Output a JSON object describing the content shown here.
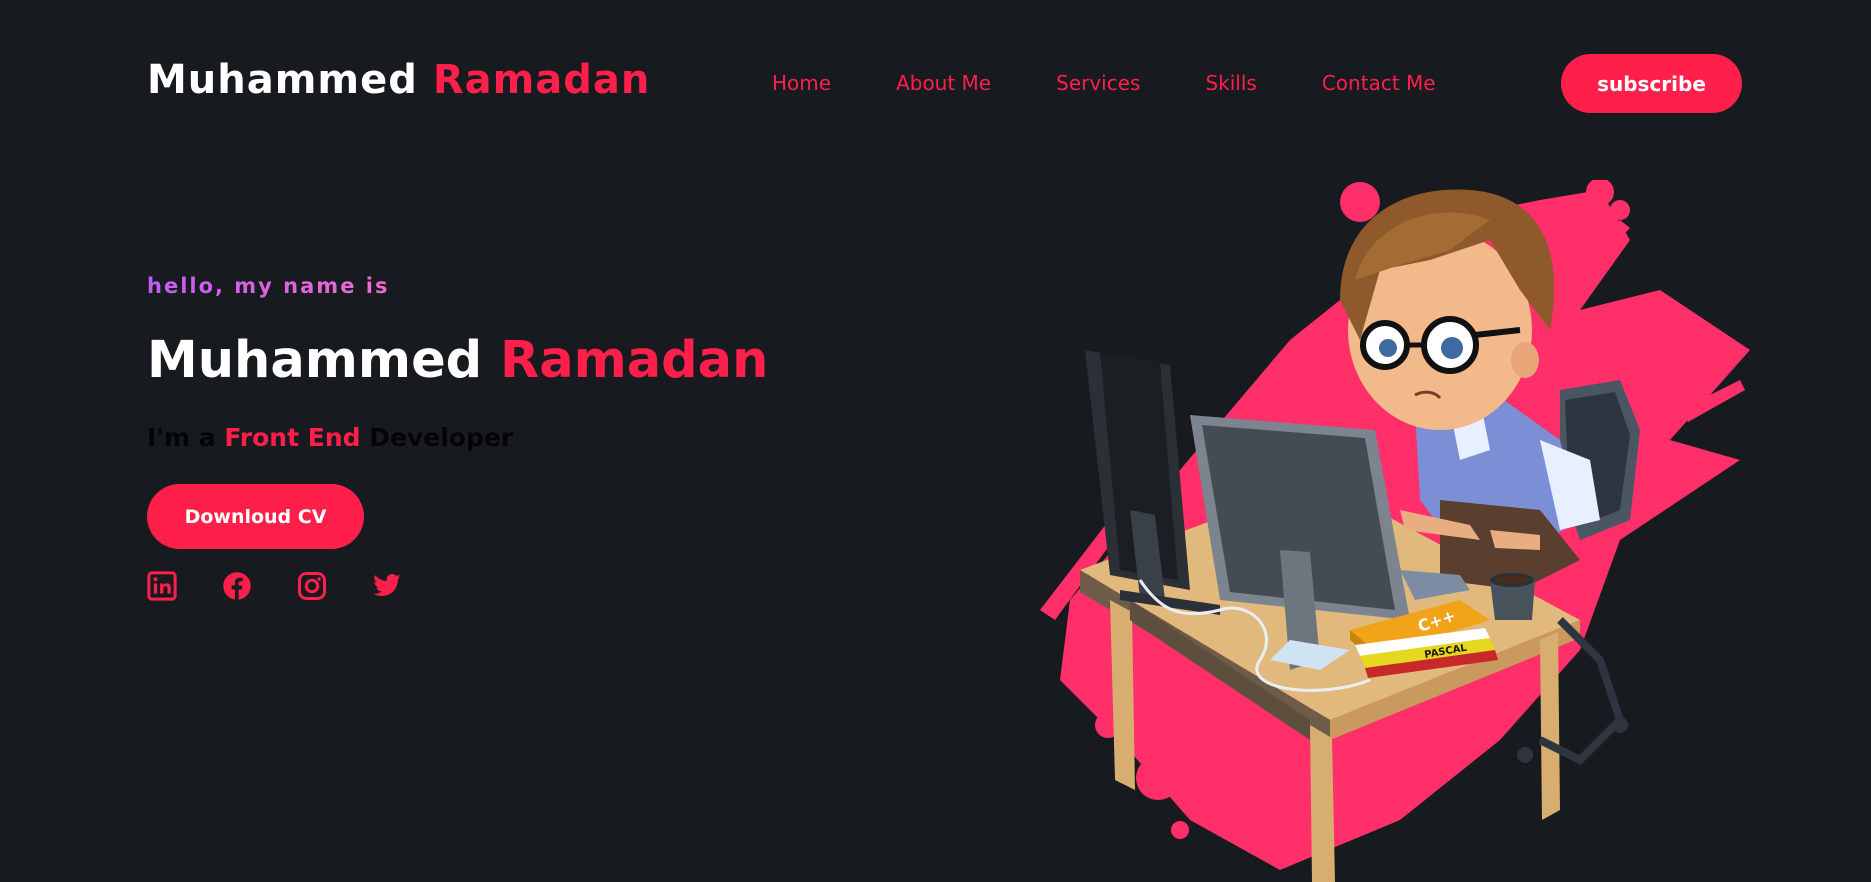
{
  "header": {
    "logo_first": "Muhammed",
    "logo_last": "Ramadan",
    "nav": [
      "Home",
      "About Me",
      "Services",
      "Skills",
      "Contact Me"
    ],
    "subscribe_label": "subscribe"
  },
  "hero": {
    "greeting": "hello, my name is",
    "name_first": "Muhammed",
    "name_last": "Ramadan",
    "role_prefix": "I'm a",
    "role_highlight": "Front End",
    "role_suffix": "Developer",
    "cv_button_label": "Downloud CV",
    "socials": [
      "linkedin-icon",
      "facebook-icon",
      "instagram-icon",
      "twitter-icon"
    ]
  },
  "illustration": {
    "book_top_label": "C++",
    "book_bottom_label": "PASCAL"
  },
  "colors": {
    "background": "#171a1e",
    "accent": "#ff1f4b",
    "text": "#ffffff",
    "greeting_gradient_start": "#c05cf5",
    "greeting_gradient_end": "#f06bcf"
  }
}
